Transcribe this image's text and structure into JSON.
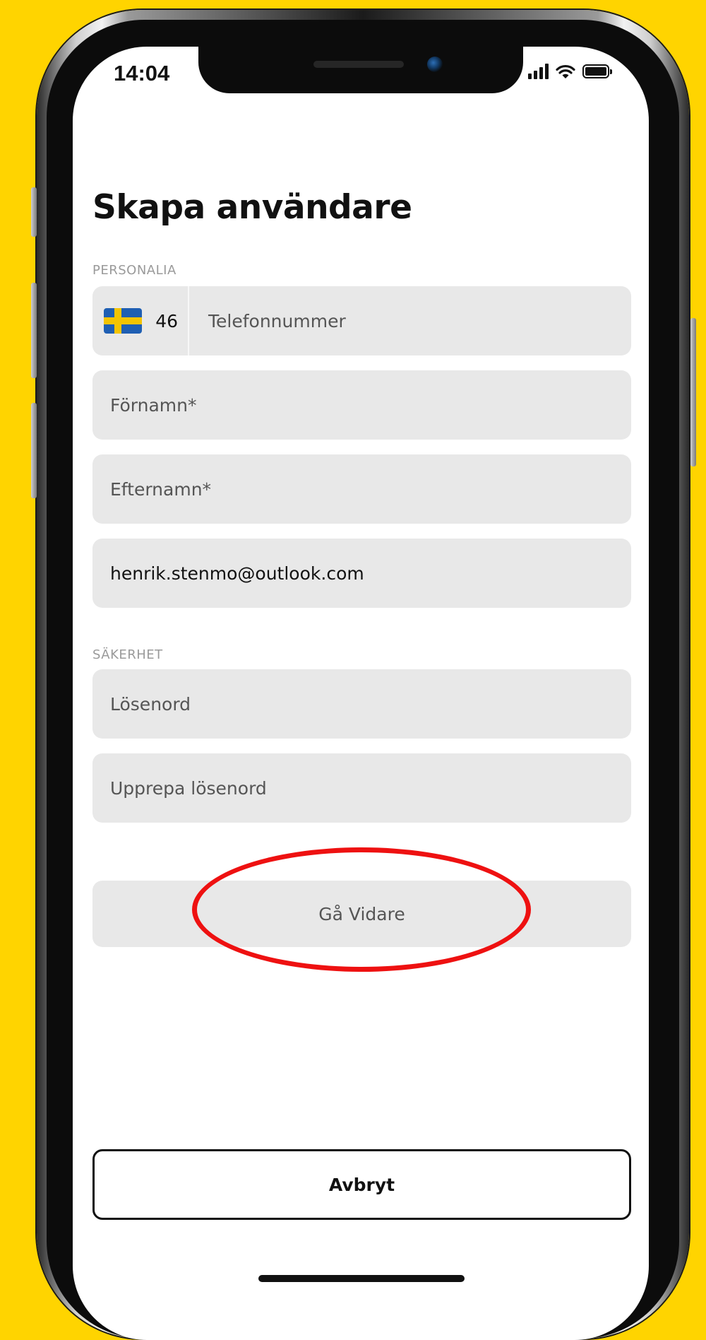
{
  "status_bar": {
    "time": "14:04",
    "icons": [
      "cellular-signal-icon",
      "wifi-icon",
      "battery-icon"
    ]
  },
  "page": {
    "title": "Skapa användare"
  },
  "personalia": {
    "section_label": "PERSONALIA",
    "phone": {
      "country_flag": "sweden-flag-icon",
      "country_code": "46",
      "placeholder": "Telefonnummer"
    },
    "first_name_placeholder": "Förnamn*",
    "last_name_placeholder": "Efternamn*",
    "email_value": "henrik.stenmo@outlook.com"
  },
  "security": {
    "section_label": "SÄKERHET",
    "password_placeholder": "Lösenord",
    "repeat_password_placeholder": "Upprepa lösenord"
  },
  "actions": {
    "continue_label": "Gå Vidare",
    "cancel_label": "Avbryt"
  },
  "colors": {
    "background": "#FFD400",
    "field_background": "#E8E8E8",
    "highlight": "#EE1111",
    "text": "#111111"
  }
}
